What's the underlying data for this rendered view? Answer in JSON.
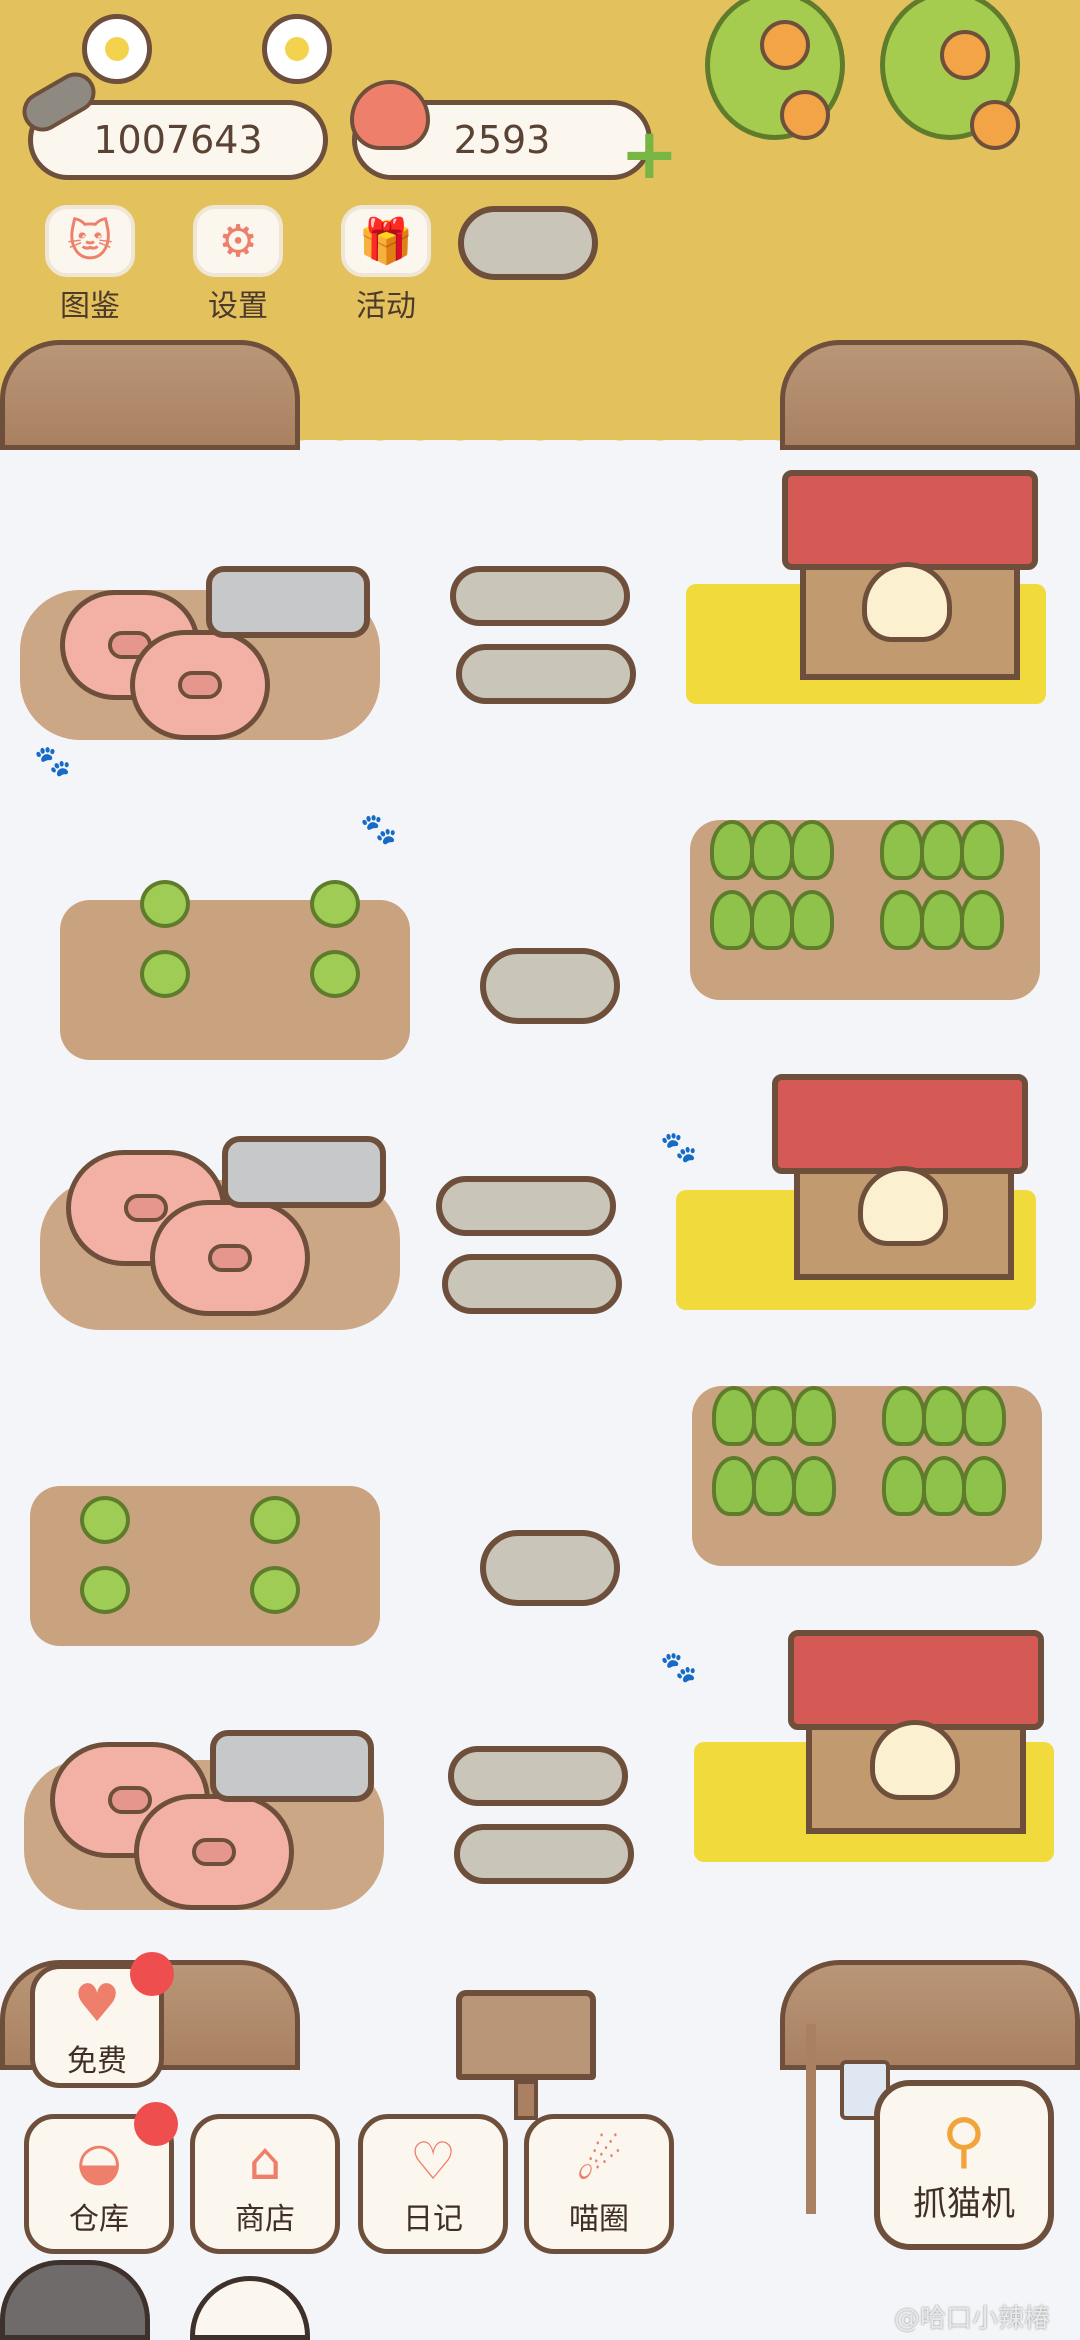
{
  "currency": {
    "coins": "1007643",
    "hearts": "2593",
    "add_symbol": "+"
  },
  "top_menu": [
    {
      "label": "图鉴",
      "icon": "cat-head-icon",
      "glyph": "🐱"
    },
    {
      "label": "设置",
      "icon": "gear-icon",
      "glyph": "⚙"
    },
    {
      "label": "活动",
      "icon": "gift-icon",
      "glyph": "🎁"
    }
  ],
  "bottom_menu": {
    "free": {
      "label": "免费",
      "icon": "heart-icon",
      "glyph": "♥"
    },
    "warehouse": {
      "label": "仓库",
      "icon": "storage-jar-icon",
      "glyph": "◒"
    },
    "shop": {
      "label": "商店",
      "icon": "shop-icon",
      "glyph": "⌂"
    },
    "diary": {
      "label": "日记",
      "icon": "notebook-icon",
      "glyph": "♡"
    },
    "circle": {
      "label": "喵圈",
      "icon": "planet-cat-icon",
      "glyph": "☄"
    },
    "claw_machine": {
      "label": "抓猫机",
      "icon": "claw-icon",
      "glyph": "⚲"
    }
  },
  "watermark": "@哈口小辣椿",
  "colors": {
    "yard": "#e3c25e",
    "field": "#c9a27f",
    "roof": "#d55a55",
    "hay": "#f1da3c",
    "badge": "#ef4e4e"
  }
}
